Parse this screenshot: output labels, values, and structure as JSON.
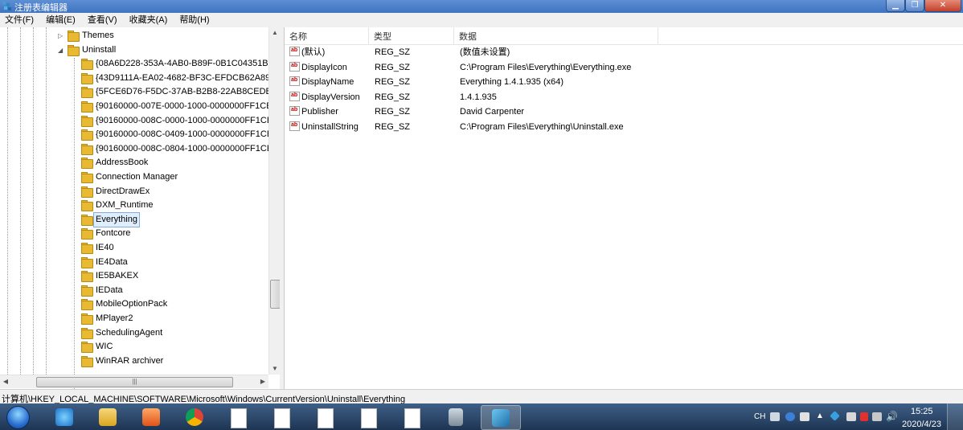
{
  "window": {
    "title": "注册表编辑器"
  },
  "menu": [
    "文件(F)",
    "编辑(E)",
    "查看(V)",
    "收藏夹(A)",
    "帮助(H)"
  ],
  "tree": {
    "items": [
      {
        "label": "Themes",
        "level": 1,
        "expander": "collapsed"
      },
      {
        "label": "Uninstall",
        "level": 1,
        "expander": "expanded"
      },
      {
        "label": "{08A6D228-353A-4AB0-B89F-0B1C04351B",
        "level": 2
      },
      {
        "label": "{43D9111A-EA02-4682-BF3C-EFDCB62A89",
        "level": 2
      },
      {
        "label": "{5FCE6D76-F5DC-37AB-B2B8-22AB8CEDB",
        "level": 2
      },
      {
        "label": "{90160000-007E-0000-1000-0000000FF1CE",
        "level": 2
      },
      {
        "label": "{90160000-008C-0000-1000-0000000FF1CE",
        "level": 2
      },
      {
        "label": "{90160000-008C-0409-1000-0000000FF1CE",
        "level": 2
      },
      {
        "label": "{90160000-008C-0804-1000-0000000FF1CE",
        "level": 2
      },
      {
        "label": "AddressBook",
        "level": 2
      },
      {
        "label": "Connection Manager",
        "level": 2
      },
      {
        "label": "DirectDrawEx",
        "level": 2
      },
      {
        "label": "DXM_Runtime",
        "level": 2
      },
      {
        "label": "Everything",
        "level": 2,
        "selected": true
      },
      {
        "label": "Fontcore",
        "level": 2
      },
      {
        "label": "IE40",
        "level": 2
      },
      {
        "label": "IE4Data",
        "level": 2
      },
      {
        "label": "IE5BAKEX",
        "level": 2
      },
      {
        "label": "IEData",
        "level": 2
      },
      {
        "label": "MobileOptionPack",
        "level": 2
      },
      {
        "label": "MPlayer2",
        "level": 2
      },
      {
        "label": "SchedulingAgent",
        "level": 2
      },
      {
        "label": "WIC",
        "level": 2
      },
      {
        "label": "WinRAR archiver",
        "level": 2
      }
    ]
  },
  "list": {
    "columns": [
      "名称",
      "类型",
      "数据"
    ],
    "rows": [
      {
        "name": "(默认)",
        "type": "REG_SZ",
        "data": "(数值未设置)",
        "icon": "reg-string-icon"
      },
      {
        "name": "DisplayIcon",
        "type": "REG_SZ",
        "data": "C:\\Program Files\\Everything\\Everything.exe",
        "icon": "reg-string-icon"
      },
      {
        "name": "DisplayName",
        "type": "REG_SZ",
        "data": "Everything 1.4.1.935 (x64)",
        "icon": "reg-string-icon"
      },
      {
        "name": "DisplayVersion",
        "type": "REG_SZ",
        "data": "1.4.1.935",
        "icon": "reg-string-icon"
      },
      {
        "name": "Publisher",
        "type": "REG_SZ",
        "data": "David Carpenter",
        "icon": "reg-string-icon"
      },
      {
        "name": "UninstallString",
        "type": "REG_SZ",
        "data": "C:\\Program Files\\Everything\\Uninstall.exe",
        "icon": "reg-string-icon"
      }
    ]
  },
  "statusbar": {
    "path": "计算机\\HKEY_LOCAL_MACHINE\\SOFTWARE\\Microsoft\\Windows\\CurrentVersion\\Uninstall\\Everything"
  },
  "taskbar": {
    "tray_language": "CH",
    "time": "15:25",
    "date": "2020/4/23"
  },
  "colors": {
    "selection_bg": "#dfeefc",
    "selection_border": "#84acdd",
    "folder": "#e8b933",
    "taskbar": "#2a4668"
  }
}
